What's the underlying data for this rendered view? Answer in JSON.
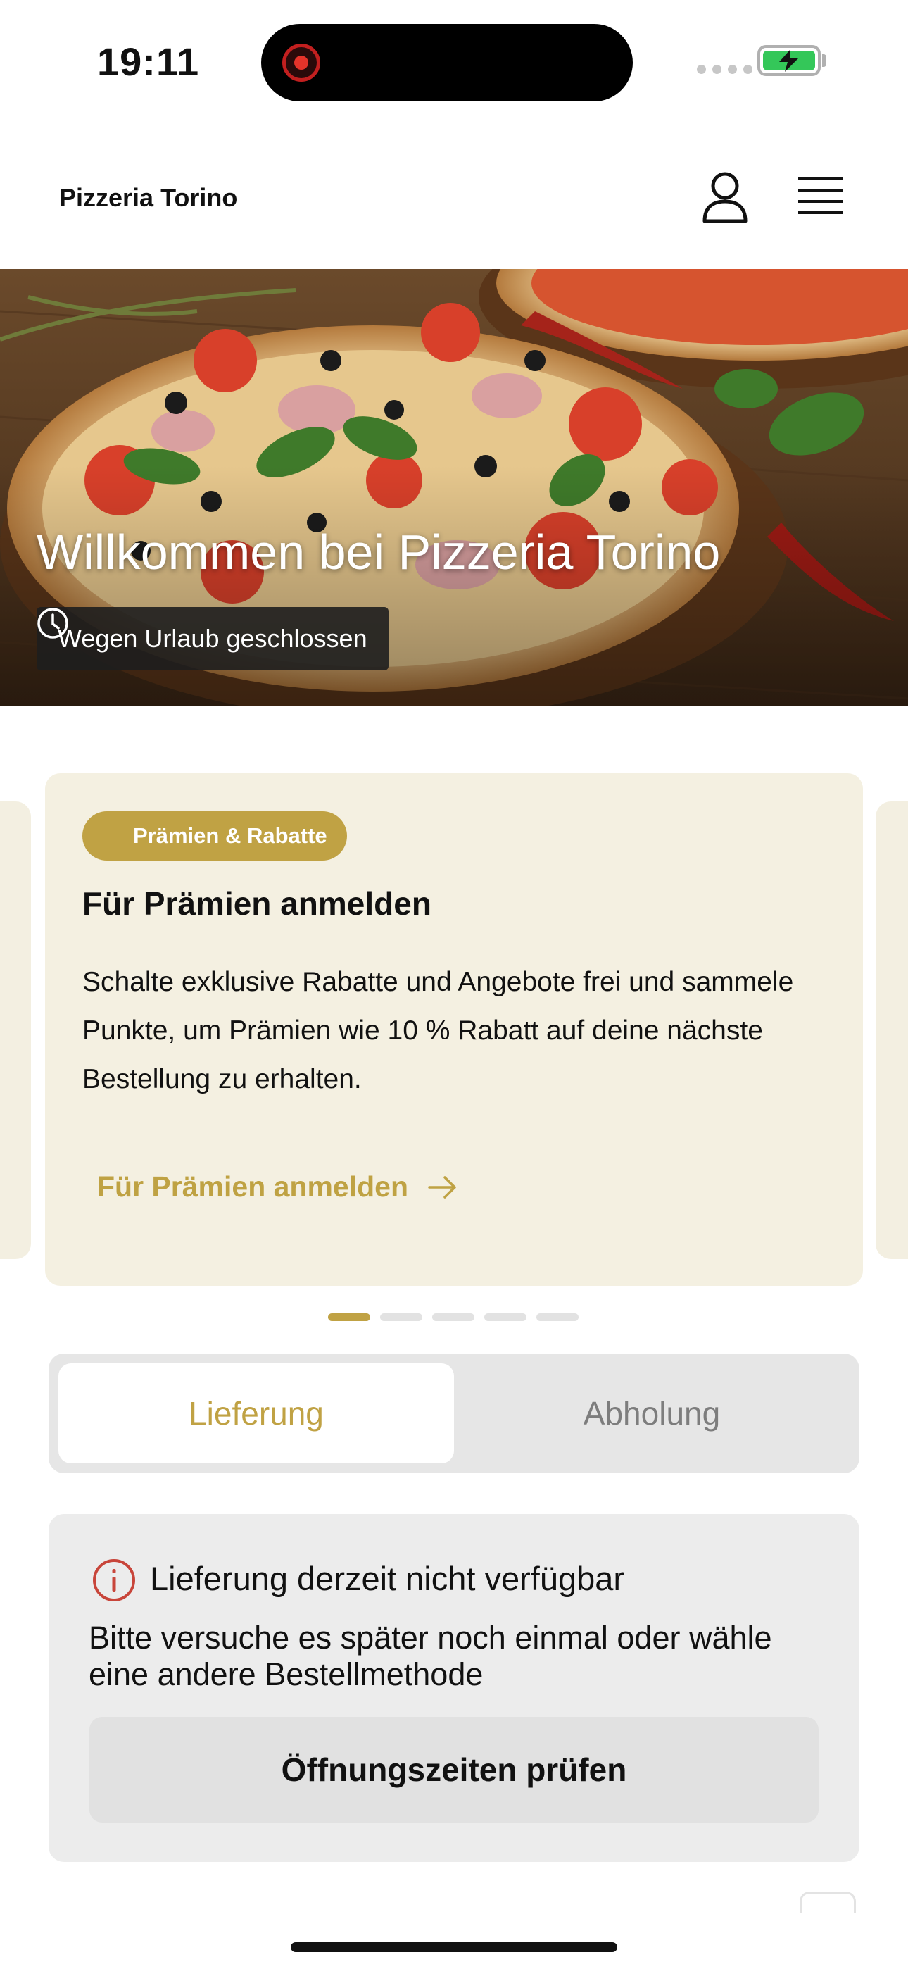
{
  "status_bar": {
    "time": "19:11"
  },
  "header": {
    "brand": "Pizzeria Torino",
    "icons": [
      "user-icon",
      "menu-icon"
    ]
  },
  "hero": {
    "title": "Willkommen bei Pizzeria Torino",
    "hours_status": "Wegen Urlaub geschlossen"
  },
  "promo": {
    "tag": "Prämien & Rabatte",
    "title": "Für Prämien anmelden",
    "text": "Schalte exklusive Rabatte und Angebote frei und sammele Punkte, um Prämien wie 10 % Rabatt auf deine nächste Bestellung zu erhalten.",
    "link_label": "Für Prämien anmelden",
    "slide_count": 5,
    "active_slide": 1
  },
  "order_mode": {
    "options": [
      "Lieferung",
      "Abholung"
    ],
    "selected": "Lieferung"
  },
  "notice": {
    "title": "Lieferung derzeit nicht verfügbar",
    "text": "Bitte versuche es später noch einmal oder wähle eine andere Bestellmethode",
    "button_label": "Öffnungszeiten prüfen"
  },
  "colors": {
    "accent_gold": "#c0a244",
    "promo_background": "#f4f0e1",
    "alert_red": "#c8453a",
    "battery_green": "#34c759"
  }
}
